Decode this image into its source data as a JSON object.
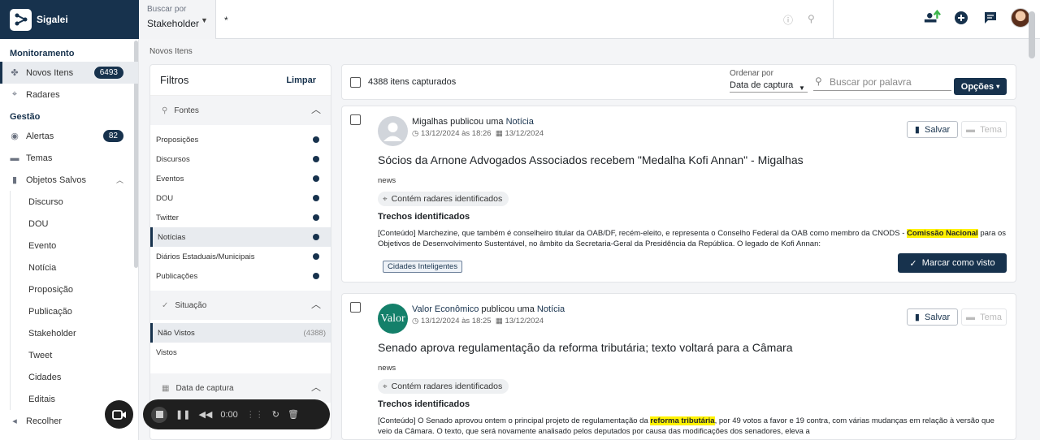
{
  "app": {
    "name": "Sigalei"
  },
  "search": {
    "by_label": "Buscar por",
    "by_value": "Stakeholder",
    "query": "*"
  },
  "sidebar": {
    "sections": [
      {
        "title": "Monitoramento"
      },
      {
        "title": "Gestão"
      }
    ],
    "monitoramento": [
      {
        "label": "Novos Itens",
        "badge": "6493",
        "icon": "nodes-icon"
      },
      {
        "label": "Radares",
        "icon": "radar-icon"
      }
    ],
    "gestao": [
      {
        "label": "Alertas",
        "badge": "82",
        "icon": "rss-icon"
      },
      {
        "label": "Temas",
        "icon": "folder-icon"
      },
      {
        "label": "Objetos Salvos",
        "icon": "bookmark-icon"
      }
    ],
    "saved": [
      "Discurso",
      "DOU",
      "Evento",
      "Notícia",
      "Proposição",
      "Publicação",
      "Stakeholder",
      "Tweet",
      "Cidades",
      "Editais"
    ],
    "collapse_label": "Recolher"
  },
  "breadcrumb": "Novos Itens",
  "filters": {
    "title": "Filtros",
    "clear": "Limpar",
    "fontes": {
      "title": "Fontes",
      "options": [
        "Proposições",
        "Discursos",
        "Eventos",
        "DOU",
        "Twitter",
        "Notícias",
        "Diários Estaduais/Municipais",
        "Publicações"
      ],
      "selected": "Notícias"
    },
    "situacao": {
      "title": "Situação",
      "options": [
        {
          "label": "Não Vistos",
          "count": "(4388)"
        },
        {
          "label": "Vistos",
          "count": ""
        }
      ]
    },
    "data": {
      "title": "Data de captura"
    }
  },
  "list": {
    "count_label": "4388 itens capturados",
    "order_label": "Ordenar por",
    "order_value": "Data de captura",
    "keyword_placeholder": "Buscar por palavra",
    "options_label": "Opções"
  },
  "cards": [
    {
      "source": "Migalhas",
      "publicou": "publicou uma",
      "kind": "Notícia",
      "date1": "13/12/2024 às 18:26",
      "date2": "13/12/2024",
      "save": "Salvar",
      "theme": "Tema",
      "title": "Sócios da Arnone Advogados Associados recebem \"Medalha Kofi Annan\" - Migalhas",
      "type": "news",
      "chip": "Contém radares identificados",
      "trechos": "Trechos identificados",
      "excerpt_pre": "[Conteúdo] Marchezine, que também é conselheiro titular da OAB/DF, recém-eleito, e representa o Conselho Federal da OAB como membro da CNODS - ",
      "excerpt_hl": "Comissão Nacional",
      "excerpt_post": " para os Objetivos de Desenvolvimento Sustentável, no âmbito da Secretaria-Geral da Presidência da República. O legado de Kofi Annan:",
      "tag": "Cidades Inteligentes",
      "seen": "Marcar como visto"
    },
    {
      "source": "Valor Econômico",
      "logo": "Valor",
      "publicou": "publicou uma",
      "kind": "Notícia",
      "date1": "13/12/2024 às 18:25",
      "date2": "13/12/2024",
      "save": "Salvar",
      "theme": "Tema",
      "title": "Senado aprova regulamentação da reforma tributária; texto voltará para a Câmara",
      "type": "news",
      "chip": "Contém radares identificados",
      "trechos": "Trechos identificados",
      "excerpt_pre": "[Conteúdo] O Senado aprovou ontem o principal projeto de regulamentação da ",
      "excerpt_hl": "reforma tributária",
      "excerpt_post": ", por 49 votos a favor e 19 contra, com várias mudanças em relação à versão que veio da Câmara. O texto, que será novamente analisado pelos deputados por causa das modificações dos senadores, eleva a"
    }
  ],
  "recorder": {
    "time": "0:00"
  },
  "colors": {
    "primary": "#17324d",
    "highlight": "#fff200"
  }
}
